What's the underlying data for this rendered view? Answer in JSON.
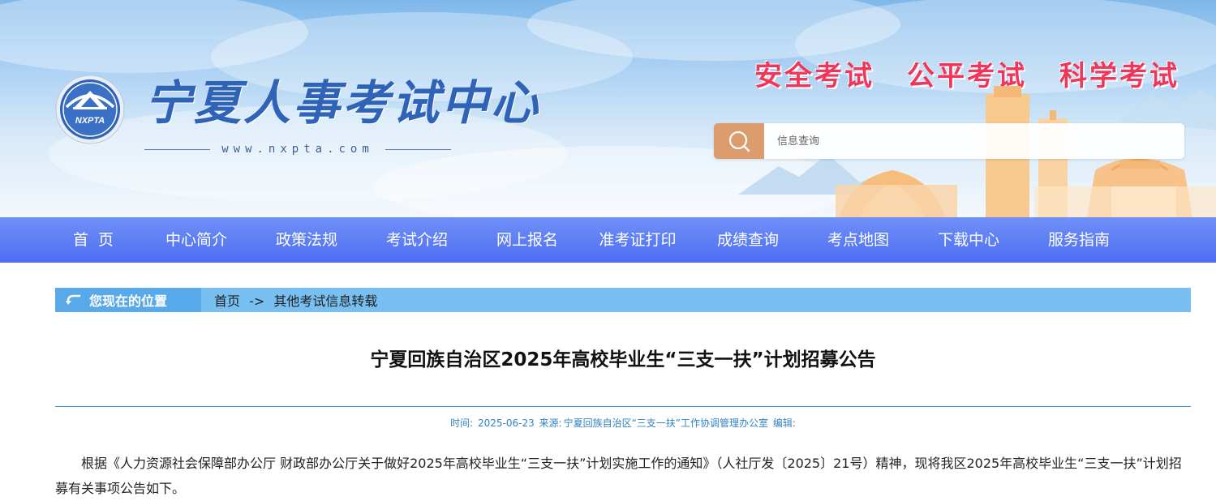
{
  "site": {
    "title": "宁夏人事考试中心",
    "url": "www.nxpta.com",
    "logo_text": "NXPTA",
    "slogans": [
      "安全考试",
      "公平考试",
      "科学考试"
    ]
  },
  "search": {
    "placeholder": "信息查询",
    "icon": "search-icon"
  },
  "nav": {
    "items": [
      "首页",
      "中心简介",
      "政策法规",
      "考试介绍",
      "网上报名",
      "准考证打印",
      "成绩查询",
      "考点地图",
      "下载中心",
      "服务指南"
    ]
  },
  "breadcrumb": {
    "label": "您现在的位置",
    "home": "首页",
    "separator": "->",
    "current": "其他考试信息转载"
  },
  "article": {
    "title": "宁夏回族自治区2025年高校毕业生“三支一扶”计划招募公告",
    "meta": {
      "time_label": "时间:",
      "time": "2025-06-23",
      "source_label": "来源:",
      "source": "宁夏回族自治区“三支一扶”工作协调管理办公室",
      "editor_label": "编辑:"
    },
    "body": "根据《人力资源社会保障部办公厅 财政部办公厅关于做好2025年高校毕业生“三支一扶”计划实施工作的通知》（人社厅发〔2025〕21号）精神，现将我区2025年高校毕业生“三支一扶”计划招募有关事项公告如下。"
  },
  "colors": {
    "brand_blue": "#2f63b8",
    "nav_blue": "#4e6ef3",
    "slogan_red": "#f0365a",
    "search_button": "#dc9c6d",
    "breadcrumb_bar": "#78c0f2",
    "meta_text": "#2f83c4"
  }
}
